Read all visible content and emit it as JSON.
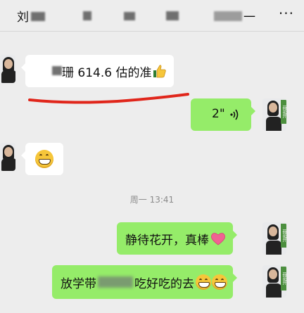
{
  "header": {
    "title_first_char": "刘",
    "title_last_chars": "一",
    "more_label": "···"
  },
  "messages": [
    {
      "side": "left",
      "type": "text",
      "text": "珊 614.6 估的准",
      "trailing_emoji": "thumbs-up-icon"
    },
    {
      "side": "right",
      "type": "voice",
      "duration": "2\""
    },
    {
      "side": "left",
      "type": "emoji",
      "emoji": "grinning-face-icon"
    },
    {
      "side": "right",
      "type": "text",
      "text": "静待花开，真棒",
      "trailing_emoji": "heart-icon"
    },
    {
      "side": "right",
      "type": "text",
      "text_before_blur": "放学带",
      "text_after_blur": "吃好吃的去",
      "trailing_emoji": "grinning-face-icon"
    }
  ],
  "timestamp": "周一 13:41",
  "avatar_badge_text": "荷花开",
  "colors": {
    "background": "#ededed",
    "outgoing_bubble": "#95ec69",
    "incoming_bubble": "#ffffff",
    "annotation_line": "#e0261b"
  }
}
